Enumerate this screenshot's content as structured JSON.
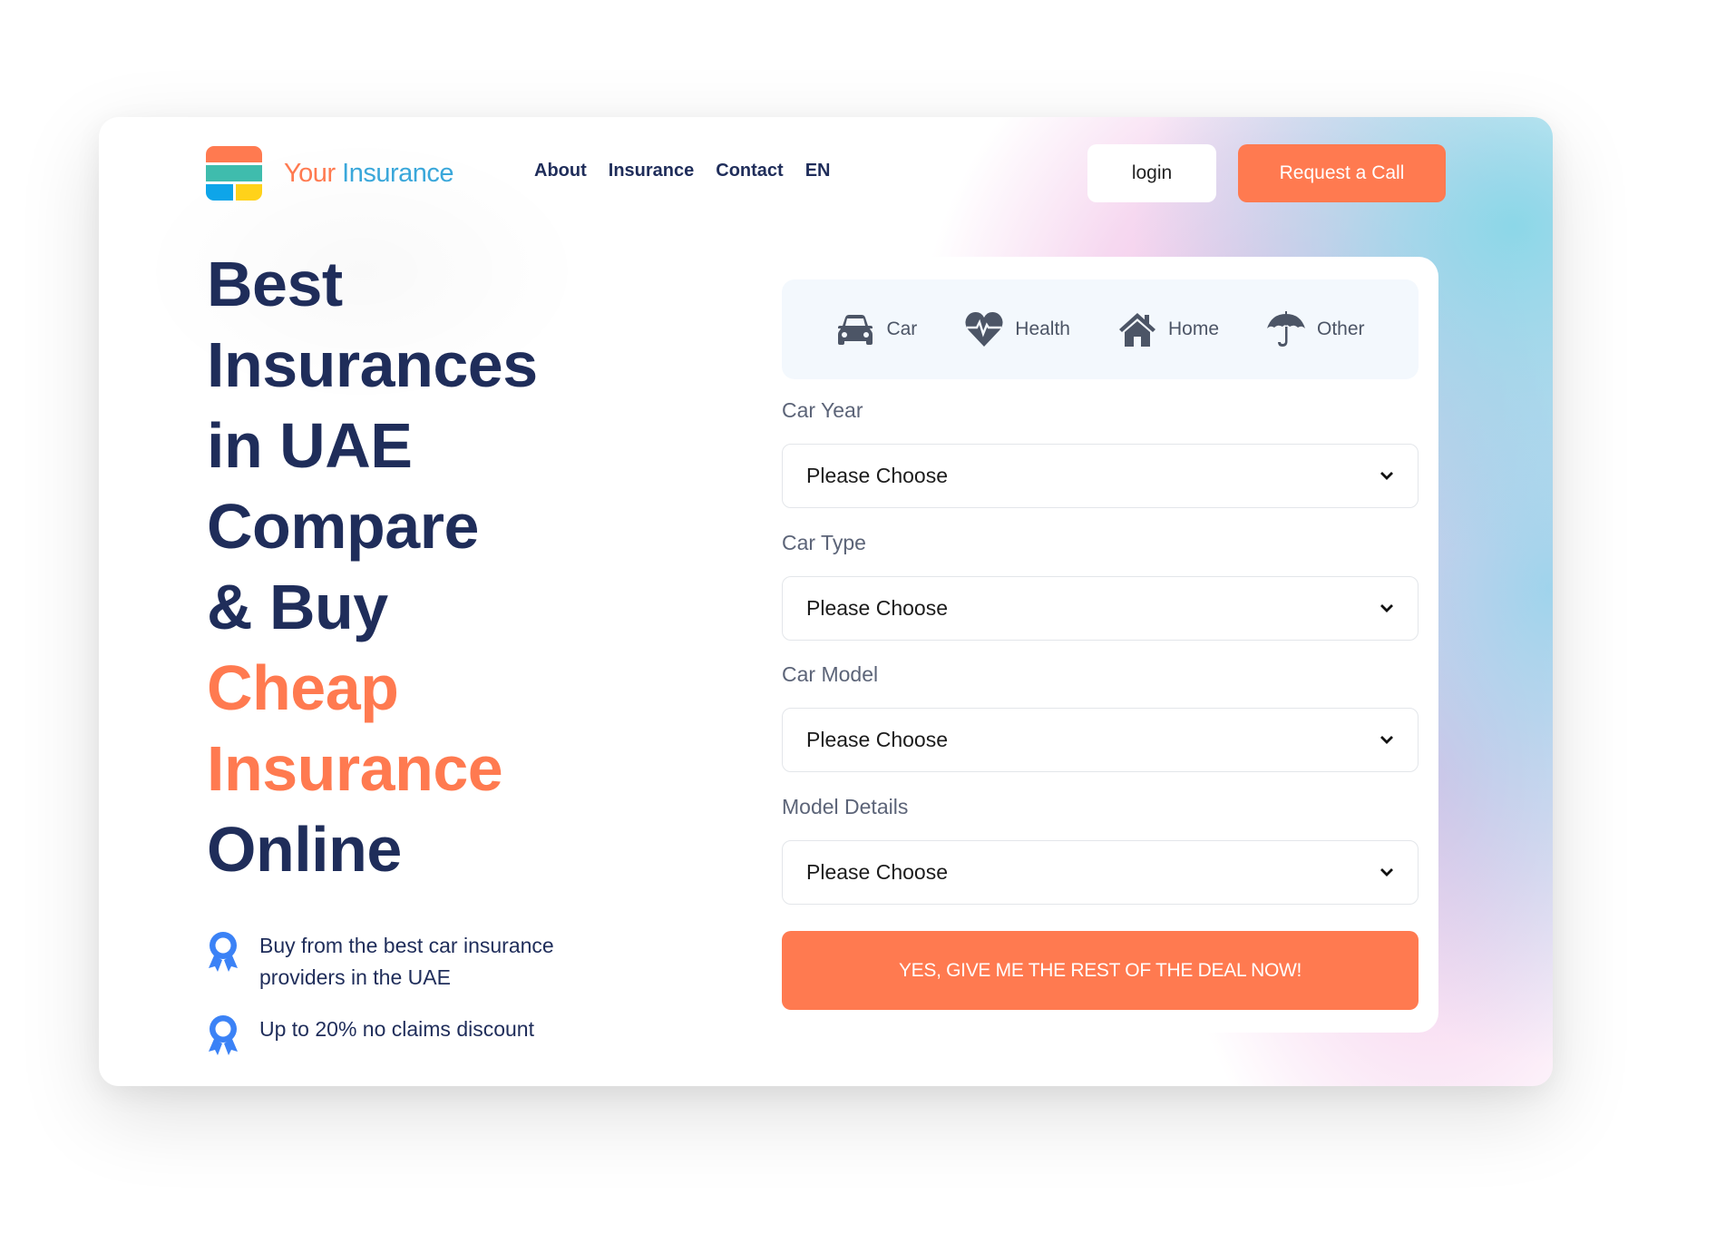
{
  "brand": {
    "name_part1": "Your",
    "name_part2": "Insurance"
  },
  "nav": {
    "items": [
      "About",
      "Insurance",
      "Contact",
      "EN"
    ]
  },
  "header": {
    "login_label": "login",
    "request_call_label": "Request a Call"
  },
  "hero": {
    "title_lines": [
      "Best",
      "Insurances",
      "in UAE",
      "Compare",
      "& Buy"
    ],
    "accent_lines": [
      "Cheap",
      "Insurance"
    ],
    "final_line": "Online",
    "benefits": [
      {
        "icon": "award-ribbon-icon",
        "text": "Buy from the best car insurance providers in the UAE"
      },
      {
        "icon": "award-ribbon-icon",
        "text": "Up to 20% no claims discount"
      }
    ]
  },
  "form": {
    "tabs": [
      {
        "label": "Car",
        "icon": "car-icon"
      },
      {
        "label": "Health",
        "icon": "heartbeat-icon"
      },
      {
        "label": "Home",
        "icon": "home-icon"
      },
      {
        "label": "Other",
        "icon": "umbrella-icon"
      }
    ],
    "fields": [
      {
        "label": "Car Year",
        "value": "Please Choose"
      },
      {
        "label": "Car Type",
        "value": "Please Choose"
      },
      {
        "label": "Car Model",
        "value": "Please Choose"
      },
      {
        "label": "Model Details",
        "value": "Please Choose"
      }
    ],
    "submit_label": "YES, GIVE ME THE REST OF THE DEAL NOW!"
  },
  "colors": {
    "primary": "#ff7a50",
    "navy": "#1f2d5a",
    "brand_blue": "#3aa7da",
    "icon_gray": "#4c5566"
  }
}
